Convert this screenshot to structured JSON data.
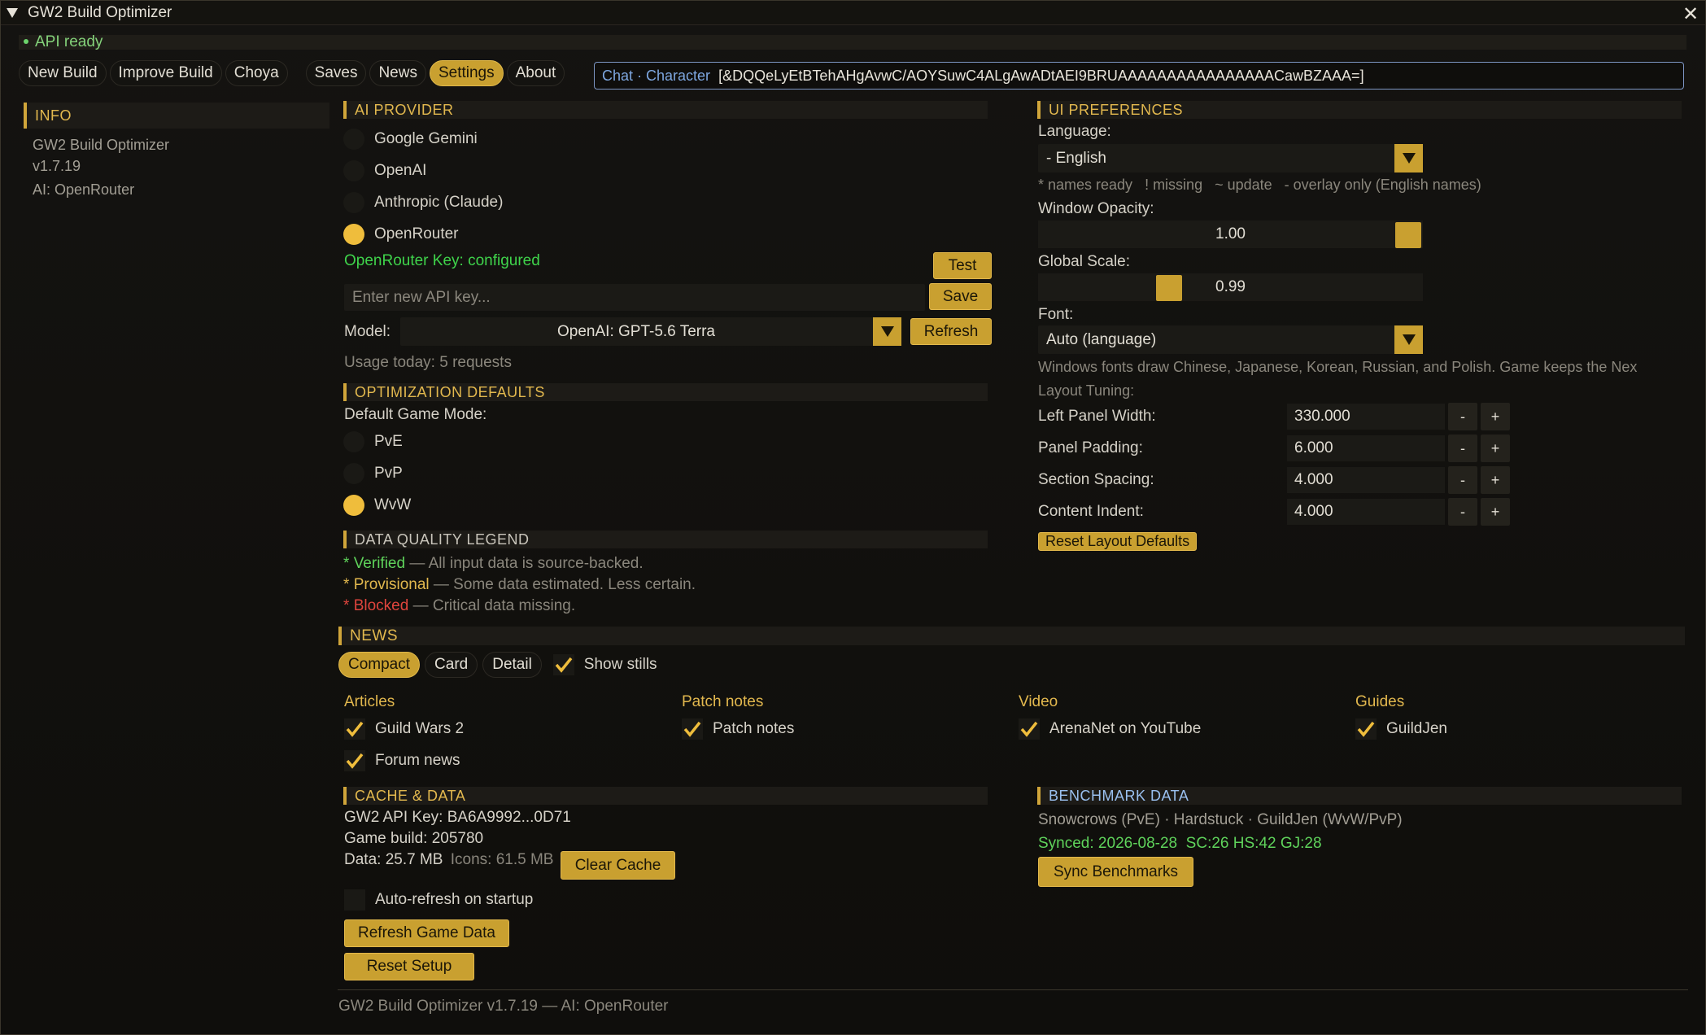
{
  "window": {
    "title": "GW2 Build Optimizer"
  },
  "status": {
    "text": "API ready"
  },
  "nav": {
    "new_build": "New Build",
    "improve_build": "Improve Build",
    "choya": "Choya",
    "saves": "Saves",
    "news": "News",
    "settings": "Settings",
    "about": "About"
  },
  "chat": {
    "label": "Chat · Character",
    "code": "[&DQQeLyEtBTehAHgAvwC/AOYSuwC4ALgAwADtAEI9BRUAAAAAAAAAAAAAAAACawBZAAA=]"
  },
  "sidebar": {
    "header": "INFO",
    "app_name": "GW2 Build Optimizer",
    "version": "v1.7.19",
    "ai": "AI: OpenRouter"
  },
  "ai_provider": {
    "header": "AI PROVIDER",
    "options": [
      "Google Gemini",
      "OpenAI",
      "Anthropic (Claude)",
      "OpenRouter"
    ],
    "selected": "OpenRouter",
    "key_status": "OpenRouter Key: configured",
    "test_label": "Test",
    "key_placeholder": "Enter new API key...",
    "save_label": "Save",
    "model_label": "Model:",
    "model_value": "OpenAI: GPT-5.6 Terra",
    "refresh_label": "Refresh",
    "usage": "Usage today: 5 requests"
  },
  "optimization": {
    "header": "OPTIMIZATION DEFAULTS",
    "mode_label": "Default Game Mode:",
    "modes": [
      "PvE",
      "PvP",
      "WvW"
    ],
    "selected": "WvW"
  },
  "legend": {
    "header": "DATA QUALITY LEGEND",
    "verified_name": "Verified",
    "verified_desc": "— All input data is source-backed.",
    "provisional_name": "Provisional",
    "provisional_desc": "— Some data estimated. Less certain.",
    "blocked_name": "Blocked",
    "blocked_desc": "— Critical data missing.",
    "marker": "*",
    "colors": {
      "verified": "#5fd35b",
      "provisional": "#e2b84e",
      "blocked": "#e0453d"
    }
  },
  "ui_prefs": {
    "header": "UI PREFERENCES",
    "language_label": "Language:",
    "language_value": "- English",
    "names_legend": "* names ready   ! missing   ~ update   - overlay only (English names)",
    "opacity_label": "Window Opacity:",
    "opacity_value": "1.00",
    "opacity_level": 1.0,
    "scale_label": "Global Scale:",
    "scale_value": "0.99",
    "font_label": "Font:",
    "font_value": "Auto (language)",
    "font_note": "Windows fonts draw Chinese, Japanese, Korean, Russian, and Polish. Game keeps the Nex",
    "layout_label": "Layout Tuning:",
    "steppers": [
      {
        "label": "Left Panel Width:",
        "value": "330.000"
      },
      {
        "label": "Panel Padding:",
        "value": "6.000"
      },
      {
        "label": "Section Spacing:",
        "value": "4.000"
      },
      {
        "label": "Content Indent:",
        "value": "4.000"
      }
    ],
    "minus": "-",
    "plus": "+",
    "reset_label": "Reset Layout Defaults"
  },
  "news": {
    "header": "NEWS",
    "views": [
      "Compact",
      "Card",
      "Detail"
    ],
    "active_view": "Compact",
    "show_stills": "Show stills",
    "columns": [
      {
        "title": "Articles",
        "items": [
          "Guild Wars 2",
          "Forum news"
        ]
      },
      {
        "title": "Patch notes",
        "items": [
          "Patch notes"
        ]
      },
      {
        "title": "Video",
        "items": [
          "ArenaNet on YouTube"
        ]
      },
      {
        "title": "Guides",
        "items": [
          "GuildJen"
        ]
      }
    ]
  },
  "cache": {
    "header": "CACHE & DATA",
    "api_key": "GW2 API Key: BA6A9992...0D71",
    "game_build": "Game build: 205780",
    "data_size": "Data: 25.7 MB",
    "icons_size": "Icons: 61.5 MB",
    "clear_label": "Clear Cache",
    "autorefresh_label": "Auto-refresh on startup",
    "refresh_label": "Refresh Game Data",
    "reset_label": "Reset Setup"
  },
  "benchmark": {
    "header": "BENCHMARK DATA",
    "sources": "Snowcrows (PvE) · Hardstuck · GuildJen (WvW/PvP)",
    "synced": "Synced: 2026-08-28  SC:26 HS:42 GJ:28",
    "sync_label": "Sync Benchmarks"
  },
  "footer": {
    "text": "GW2 Build Optimizer v1.7.19  —  AI: OpenRouter"
  }
}
